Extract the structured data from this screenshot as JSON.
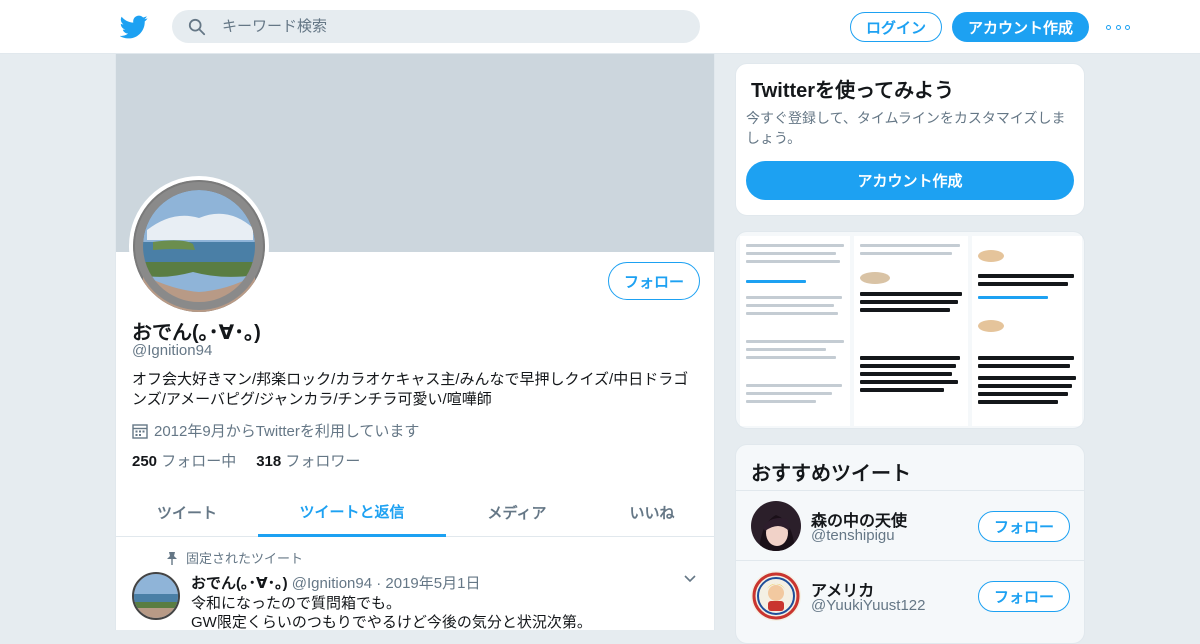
{
  "header": {
    "search_placeholder": "キーワード検索",
    "login_label": "ログイン",
    "signup_label": "アカウント作成"
  },
  "profile": {
    "follow_label": "フォロー",
    "name": "おでん(｡･∀･｡)",
    "handle": "@Ignition94",
    "bio": "オフ会大好きマン/邦楽ロック/カラオケキャス主/みんなで早押しクイズ/中日ドラゴンズ/アメーバピグ/ジャンカラ/チンチラ可愛い/喧嘩師",
    "joined": "2012年9月からTwitterを利用しています",
    "following_count": "250",
    "following_label": "フォロー中",
    "followers_count": "318",
    "followers_label": "フォロワー"
  },
  "tabs": [
    "ツイート",
    "ツイートと返信",
    "メディア",
    "いいね"
  ],
  "tweet": {
    "pinned_label": "固定されたツイート",
    "name": "おでん(｡･∀･｡)",
    "meta": "@Ignition94 · 2019年5月1日",
    "line1": "令和になったので質問箱でも。",
    "line2": "GW限定くらいのつもりでやるけど今後の気分と状況次第。"
  },
  "signup_card": {
    "title": "Twitterを使ってみよう",
    "text": "今すぐ登録して、タイムラインをカスタマイズしましょう。",
    "button": "アカウント作成"
  },
  "recommend": {
    "title": "おすすめツイート",
    "items": [
      {
        "name": "森の中の天使",
        "handle": "@tenshipigu",
        "follow": "フォロー"
      },
      {
        "name": "アメリカ",
        "handle": "@YuukiYuust122",
        "follow": "フォロー"
      }
    ]
  },
  "colors": {
    "accent": "#1da1f2",
    "banner": "#ccd6dd",
    "background": "#e6ecf0"
  }
}
